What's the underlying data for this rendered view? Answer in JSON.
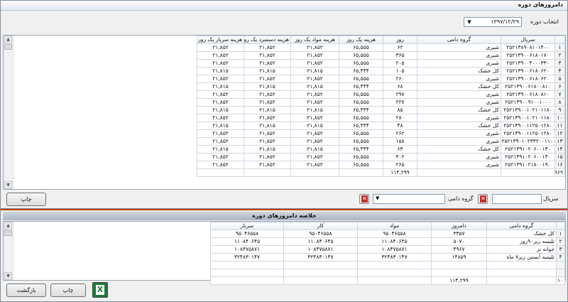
{
  "window": {
    "title": "دامروزهای دوره"
  },
  "filter": {
    "period_label": "انتخاب دوره",
    "period_value": "۱۳۹۷/۱۲/۲۹"
  },
  "grid1": {
    "headers": [
      "سریال",
      "گروه دامی",
      "روز",
      "هزینه یک روز",
      "هزینه مواد یک روز",
      "هزینه دستمزد یک روز",
      "هزینه سربار یک روز"
    ],
    "rows": [
      {
        "n": "۱",
        "serial": "۲۵۲۱۳۸۹۰۸۱۰۱۴۰۰",
        "group": "شیری",
        "day": "۶۲",
        "c1": "۶۵,۵۵۵",
        "c2": "۲۱,۸۵۲",
        "c3": "۲۱,۸۵۲",
        "c4": "۲۱,۸۵۲"
      },
      {
        "n": "۲",
        "serial": "۲۵۲۱۳۹۰۰۶۱۸۰۱۷۰",
        "group": "شیری",
        "day": "۳۶۵",
        "c1": "۶۵,۵۵۵",
        "c2": "۲۱,۸۵۲",
        "c3": "۲۱,۸۵۲",
        "c4": "۲۱,۸۵۲"
      },
      {
        "n": "۳",
        "serial": "۲۵۲۱۳۹۰۰۴۰۰۰۳۳۰",
        "group": "شیری",
        "day": "۲۰۵",
        "c1": "۶۵,۵۵۵",
        "c2": "۲۱,۸۵۲",
        "c3": "۲۱,۸۵۲",
        "c4": "۲۱,۸۵۲"
      },
      {
        "n": "۴",
        "serial": "۲۵۲۱۳۹۰۰۶۱۸۰۶۲۰",
        "group": "کل خشک",
        "day": "۱۰۵",
        "c1": "۶۵,۴۴۴",
        "c2": "۲۱,۸۱۵",
        "c3": "۲۱,۸۱۵",
        "c4": "۲۱,۸۱۵"
      },
      {
        "n": "۵",
        "serial": "۲۵۲۱۳۹۰۰۶۱۸۰۶۲۰",
        "group": "شیری",
        "day": "۲۶۰",
        "c1": "۶۵,۵۵۵",
        "c2": "۲۱,۸۵۲",
        "c3": "۲۱,۸۵۲",
        "c4": "۲۱,۸۵۲"
      },
      {
        "n": "۶",
        "serial": "۲۵۲۱۳۹۰۰۶۱۸۰۰۸۱۰",
        "group": "کل خشک",
        "day": "۶۸",
        "c1": "۶۵,۴۴۴",
        "c2": "۲۱,۸۱۵",
        "c3": "۲۱,۸۱۵",
        "c4": "۲۱,۸۱۵"
      },
      {
        "n": "۷",
        "serial": "۲۵۲۱۳۹۰۰۶۱۸۰۸۱۰",
        "group": "شیری",
        "day": "۲۹۷",
        "c1": "۶۵,۵۵۵",
        "c2": "۲۱,۸۵۲",
        "c3": "۲۱,۸۵۲",
        "c4": "۲۱,۸۵۲"
      },
      {
        "n": "۸",
        "serial": "۲۵۲۱۳۹۰۰۹۱۰۰۱۰۰۰",
        "group": "شیری",
        "day": "۲۲۷",
        "c1": "۶۵,۵۵۵",
        "c2": "۲۱,۸۵۲",
        "c3": "۲۱,۸۵۲",
        "c4": "۲۱,۸۵۲"
      },
      {
        "n": "۹",
        "serial": "۲۵۲۱۳۹۰۰۱۰۲۱۰۱۱۸۰",
        "group": "کل خشک",
        "day": "۸۵",
        "c1": "۶۵,۴۴۴",
        "c2": "۲۱,۸۱۵",
        "c3": "۲۱,۸۱۵",
        "c4": "۲۱,۸۱۵"
      },
      {
        "n": "۱۰",
        "serial": "۲۵۲۱۳۹۰۰۱۰۲۱۰۱۱۸۰",
        "group": "شیری",
        "day": "۲۸۰",
        "c1": "۶۵,۵۵۵",
        "c2": "۲۱,۸۵۲",
        "c3": "۲۱,۸۵۲",
        "c4": "۲۱,۸۵۲"
      },
      {
        "n": "۱۱",
        "serial": "۲۵۲۱۳۹۰۰۱۱۲۵۰۱۲۸۰",
        "group": "کل خشک",
        "day": "۴۸",
        "c1": "۶۵,۴۴۴",
        "c2": "۲۱,۸۱۵",
        "c3": "۲۱,۸۱۵",
        "c4": "۲۱,۸۱۵"
      },
      {
        "n": "۱۲",
        "serial": "۲۵۲۱۳۹۰۰۱۱۲۵۰۱۲۸۰",
        "group": "شیری",
        "day": "۲۶۲",
        "c1": "۶۵,۵۵۵",
        "c2": "۲۱,۸۵۲",
        "c3": "۲۱,۸۵۲",
        "c4": "۲۱,۸۵۲"
      },
      {
        "n": "۱۳",
        "serial": "۲۵۲۱۳۹۰۱۰۲۳۳۲۰۰۱۱۰",
        "group": "شیری",
        "day": "۱۵۸",
        "c1": "۶۵,۵۵۵",
        "c2": "۲۱,۸۵۲",
        "c3": "۲۱,۸۵۲",
        "c4": "۲۱,۸۵۲"
      },
      {
        "n": "۱۴",
        "serial": "۲۵۲۱۳۹۱۰۲۰۶۰۰۱۴۰",
        "group": "کل خشک",
        "day": "۶۳",
        "c1": "۶۵,۴۴۴",
        "c2": "۲۱,۸۱۵",
        "c3": "۲۱,۸۱۵",
        "c4": "۲۱,۸۱۵"
      },
      {
        "n": "۱۵",
        "serial": "۲۵۲۱۳۹۱۰۲۰۶۰۰۱۴۰",
        "group": "شیری",
        "day": "۳۰۲",
        "c1": "۶۵,۵۵۵",
        "c2": "۲۱,۸۵۲",
        "c3": "۲۱,۸۵۲",
        "c4": "۲۱,۸۵۲"
      },
      {
        "n": "۱۶",
        "serial": "۲۵۲۱۳۹۱۰۲۱۸۰۰۱۹۰",
        "group": "شیری",
        "day": "۲۶۵",
        "c1": "۶۵,۵۵۵",
        "c2": "۲۱,۸۵۲",
        "c3": "۲۱,۸۵۲",
        "c4": "۲۱,۸۵۲"
      }
    ],
    "total_count": "۹۶۹",
    "total_day": "۱۱۴,۲۹۹"
  },
  "filters2": {
    "serial_label": "سریال",
    "group_label": "گروه دامی"
  },
  "buttons": {
    "print1": "چاپ",
    "print2": "چاپ",
    "back": "بازگشت",
    "excel": "X"
  },
  "summary": {
    "title": "خلاصه دامروزهای دوره",
    "headers": [
      "گروه دامی",
      "دامروز",
      "مواد",
      "کار",
      "سربار"
    ],
    "rows": [
      {
        "n": "۱",
        "group": "کل خشک",
        "dr": "۳۳۵۷",
        "mat": "۹۵۰۴۶۵۵۸",
        "work": "۹۵۰۴۶۵۵۸",
        "oh": "۹۵۰۴۶۵۵۸"
      },
      {
        "n": "۲",
        "group": "تلیسه زیر۹۰روز",
        "dr": "۵۰۷۰",
        "mat": "۱۱۰۸۴۰۶۴۵",
        "work": "۱۱۰۸۴۰۶۴۵",
        "oh": "۱۱۰۸۴۰۶۴۵"
      },
      {
        "n": "۳",
        "group": "جوانه بز",
        "dr": "۴۹۶۷",
        "mat": "۱۰۸۴۷۵۸۷۱",
        "work": "۱۰۸۴۷۵۸۷۱",
        "oh": "۱۰۸۴۷۵۸۷۱"
      },
      {
        "n": "۴",
        "group": "تلیسه آبستن زیر۷ ماه",
        "dr": "۱۴۸۵۹",
        "mat": "۳۲۴۸۳۰۱۴۷",
        "work": "۳۲۴۸۳۰۱۴۷",
        "oh": "۳۲۴۸۳۰۱۴۷"
      }
    ],
    "total_count": "۱۰",
    "total_dr": "۱۱۴,۲۹۹"
  }
}
